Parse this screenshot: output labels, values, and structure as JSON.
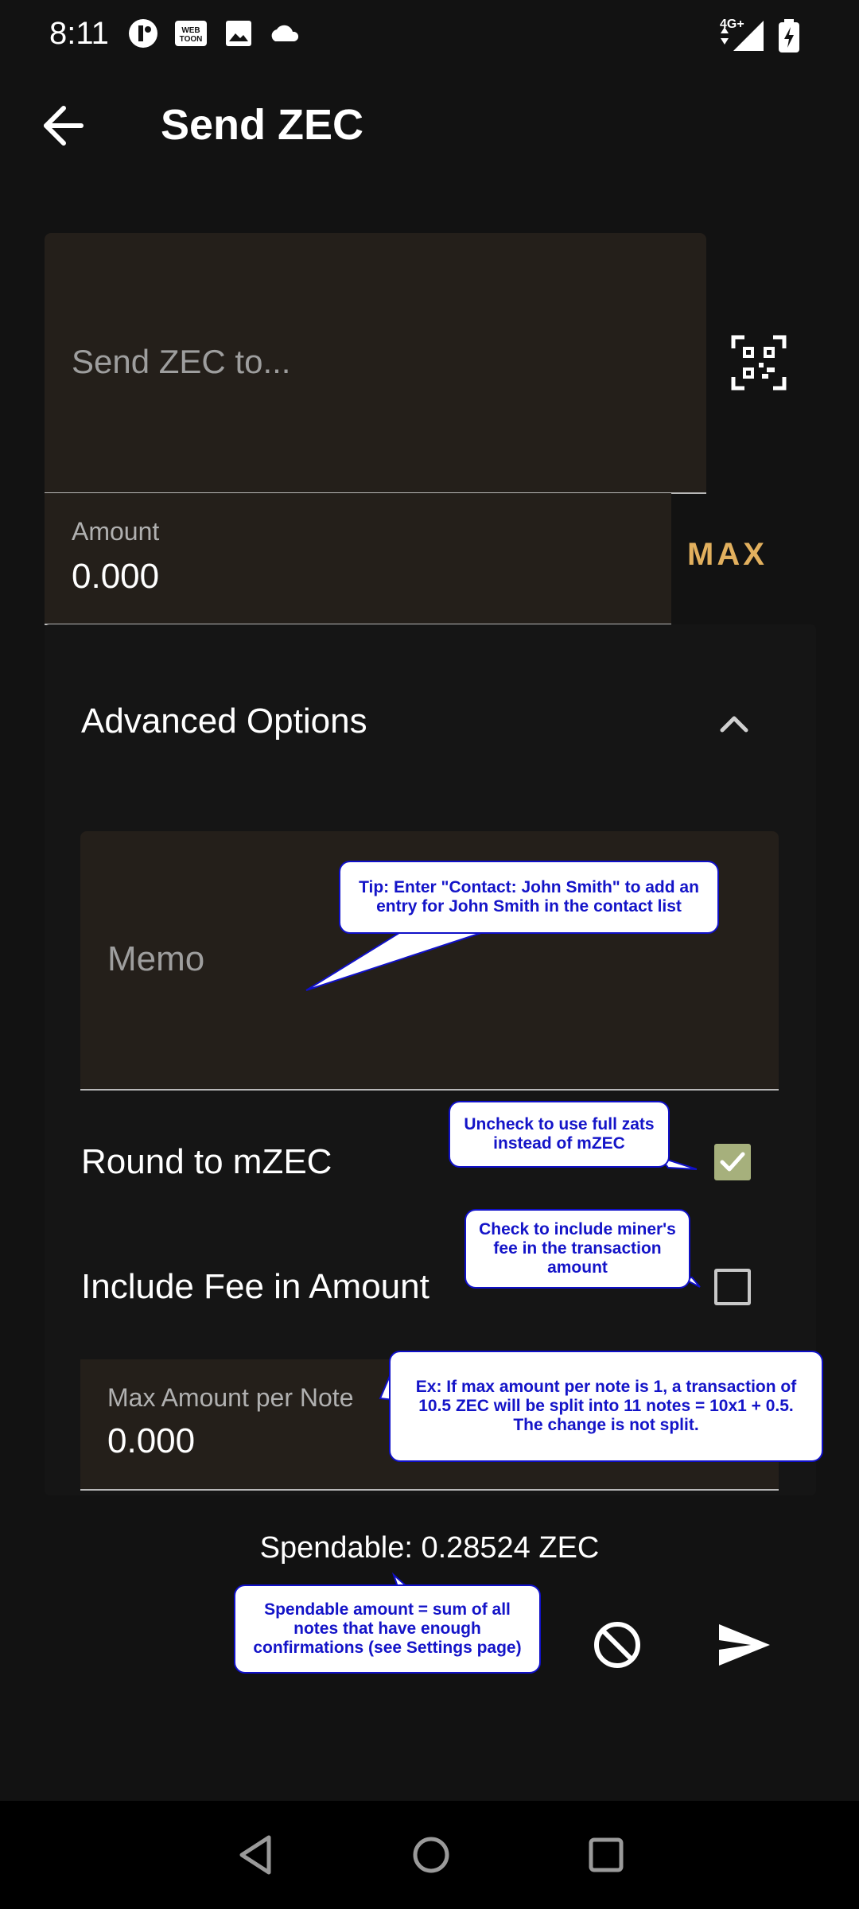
{
  "status": {
    "time": "8:11",
    "network": "4G+"
  },
  "header": {
    "title": "Send ZEC"
  },
  "address": {
    "placeholder": "Send ZEC to..."
  },
  "amount": {
    "label": "Amount",
    "value": "0.000",
    "max_label": "MAX"
  },
  "advanced": {
    "title": "Advanced Options",
    "memo_placeholder": "Memo",
    "round_label": "Round to mZEC",
    "round_checked": true,
    "fee_label": "Include Fee in Amount",
    "fee_checked": false,
    "max_note_label": "Max Amount per Note",
    "max_note_value": "0.000"
  },
  "footer": {
    "spendable": "Spendable: 0.28524 ZEC"
  },
  "tips": {
    "memo": "Tip: Enter \"Contact: John Smith\" to add an entry for John Smith in the contact list",
    "round": "Uncheck to use full zats instead of mZEC",
    "fee": "Check to include miner's fee in the transaction amount",
    "max_note": "Ex: If max amount per note is 1, a transaction of 10.5 ZEC will be split into 11 notes = 10x1 + 0.5. The change is not split.",
    "spendable": "Spendable amount = sum of all notes that have enough confirmations (see Settings page)"
  },
  "colors": {
    "accent": "#e2b05e",
    "check": "#a6b07c",
    "callout_text": "#1414c8"
  }
}
